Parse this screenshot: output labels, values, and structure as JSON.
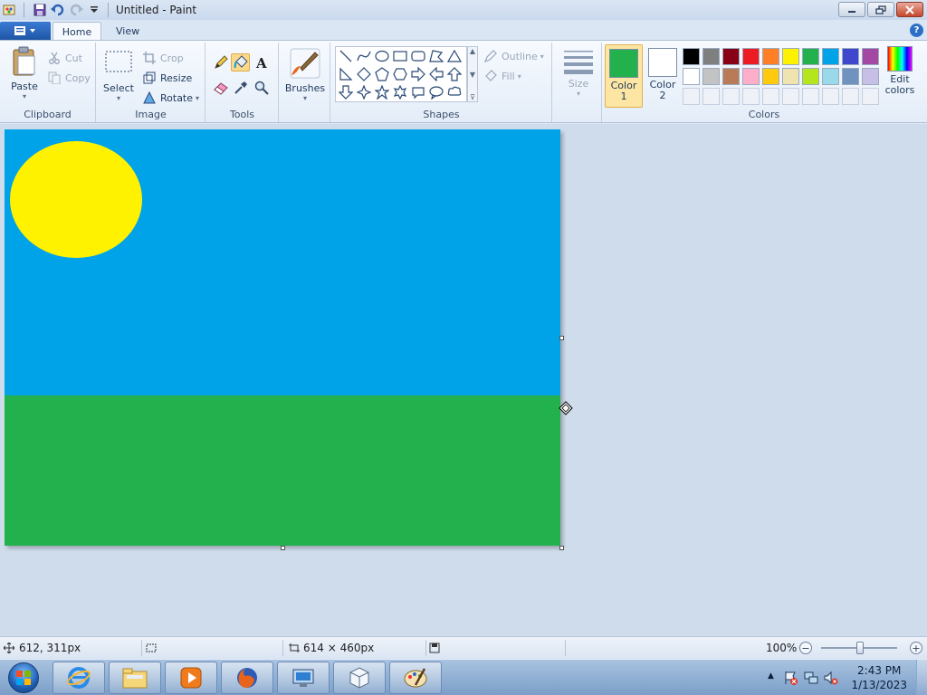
{
  "window": {
    "title": "Untitled - Paint"
  },
  "tabs": {
    "home": "Home",
    "view": "View"
  },
  "clipboard": {
    "group_label": "Clipboard",
    "paste": "Paste",
    "cut": "Cut",
    "copy": "Copy"
  },
  "image": {
    "group_label": "Image",
    "select": "Select",
    "crop": "Crop",
    "resize": "Resize",
    "rotate": "Rotate"
  },
  "tools": {
    "group_label": "Tools"
  },
  "brushes": {
    "label": "Brushes"
  },
  "shapes": {
    "group_label": "Shapes",
    "outline": "Outline",
    "fill": "Fill"
  },
  "size": {
    "label": "Size"
  },
  "colors": {
    "group_label": "Colors",
    "color1_line1": "Color",
    "color1_line2": "1",
    "color2_line1": "Color",
    "color2_line2": "2",
    "edit_line1": "Edit",
    "edit_line2": "colors",
    "color1_value": "#22b14c",
    "color2_value": "#ffffff",
    "row1": [
      "#000000",
      "#7f7f7f",
      "#880015",
      "#ed1c24",
      "#ff7f27",
      "#fff200",
      "#22b14c",
      "#00a2e8",
      "#3f48cc",
      "#a349a4"
    ],
    "row2": [
      "#ffffff",
      "#c3c3c3",
      "#b97a57",
      "#ffaec9",
      "#ffc90e",
      "#efe4b0",
      "#b5e61d",
      "#99d9ea",
      "#7092be",
      "#c8bfe7"
    ]
  },
  "drawing": {
    "sky_color": "#00a2e8",
    "ground_color": "#22b14c",
    "sun_color": "#fff200"
  },
  "status": {
    "cursor_pos": "612, 311px",
    "canvas_size": "614 × 460px",
    "zoom": "100%"
  },
  "taskbar": {
    "time": "2:43 PM",
    "date": "1/13/2023"
  }
}
